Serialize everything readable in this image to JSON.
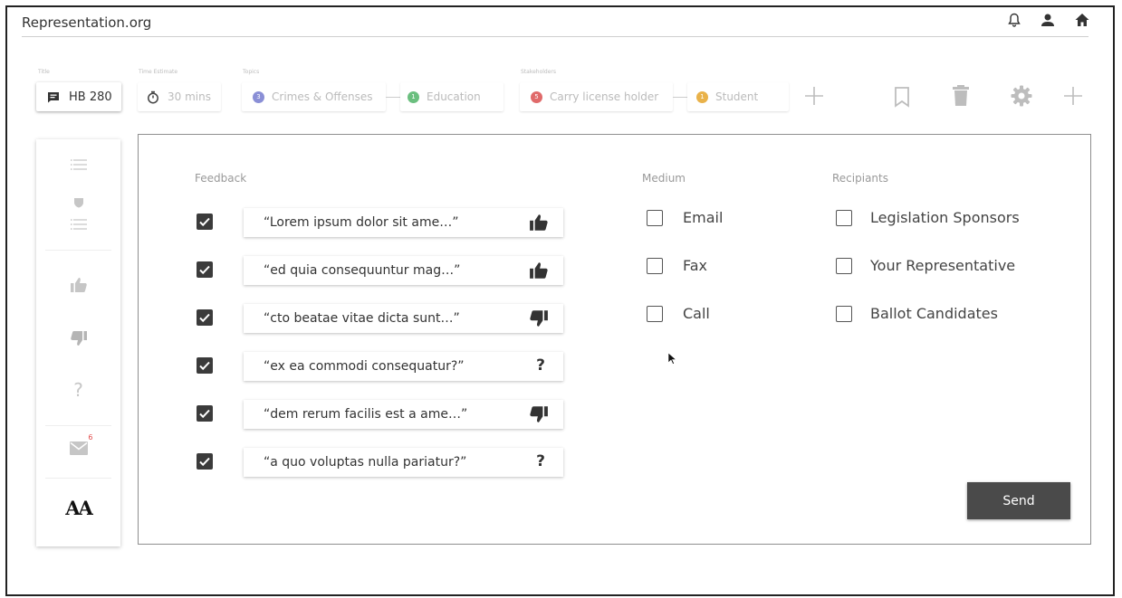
{
  "app": {
    "title": "Representation.org"
  },
  "top_icons": [
    "bell-icon",
    "user-icon",
    "home-icon"
  ],
  "header": {
    "title_label": "Title",
    "time_label": "Time Estimate",
    "topics_label": "Topics",
    "stakeholders_label": "Stakeholders",
    "bill": "HB 280",
    "time": "30 mins",
    "topics": [
      {
        "label": "Crimes & Offenses",
        "badge": "3",
        "color": "#8a8fd6"
      },
      {
        "label": "Education",
        "badge": "1",
        "color": "#6bbf7f"
      }
    ],
    "stakeholders": [
      {
        "label": "Carry license holder",
        "badge": "5",
        "color": "#e06a6a"
      },
      {
        "label": "Student",
        "badge": "1",
        "color": "#e9b24a"
      }
    ]
  },
  "sidebar": {
    "mail_count": "6",
    "font_button": "AA"
  },
  "feedback": {
    "label": "Feedback",
    "items": [
      {
        "text": "“Lorem ipsum dolor sit ame…”",
        "sentiment": "thumbs-up",
        "checked": true
      },
      {
        "text": "“ed quia consequuntur mag…”",
        "sentiment": "thumbs-up",
        "checked": true
      },
      {
        "text": "“cto beatae vitae dicta sunt…”",
        "sentiment": "thumbs-down",
        "checked": true
      },
      {
        "text": "“ex ea commodi consequatur?”",
        "sentiment": "question",
        "checked": true
      },
      {
        "text": "“dem rerum facilis est a ame…”",
        "sentiment": "thumbs-down",
        "checked": true
      },
      {
        "text": "“a quo voluptas nulla pariatur?”",
        "sentiment": "question",
        "checked": true
      }
    ],
    "question_glyph": "?"
  },
  "medium": {
    "label": "Medium",
    "options": [
      "Email",
      "Fax",
      "Call"
    ]
  },
  "recipients": {
    "label": "Recipiants",
    "options": [
      "Legislation Sponsors",
      "Your Representative",
      "Ballot Candidates"
    ]
  },
  "send_button": "Send",
  "colors": {
    "dark": "#3b3b3b",
    "light_icon": "#bdbdbd",
    "badge_red": "#e24b4b"
  }
}
